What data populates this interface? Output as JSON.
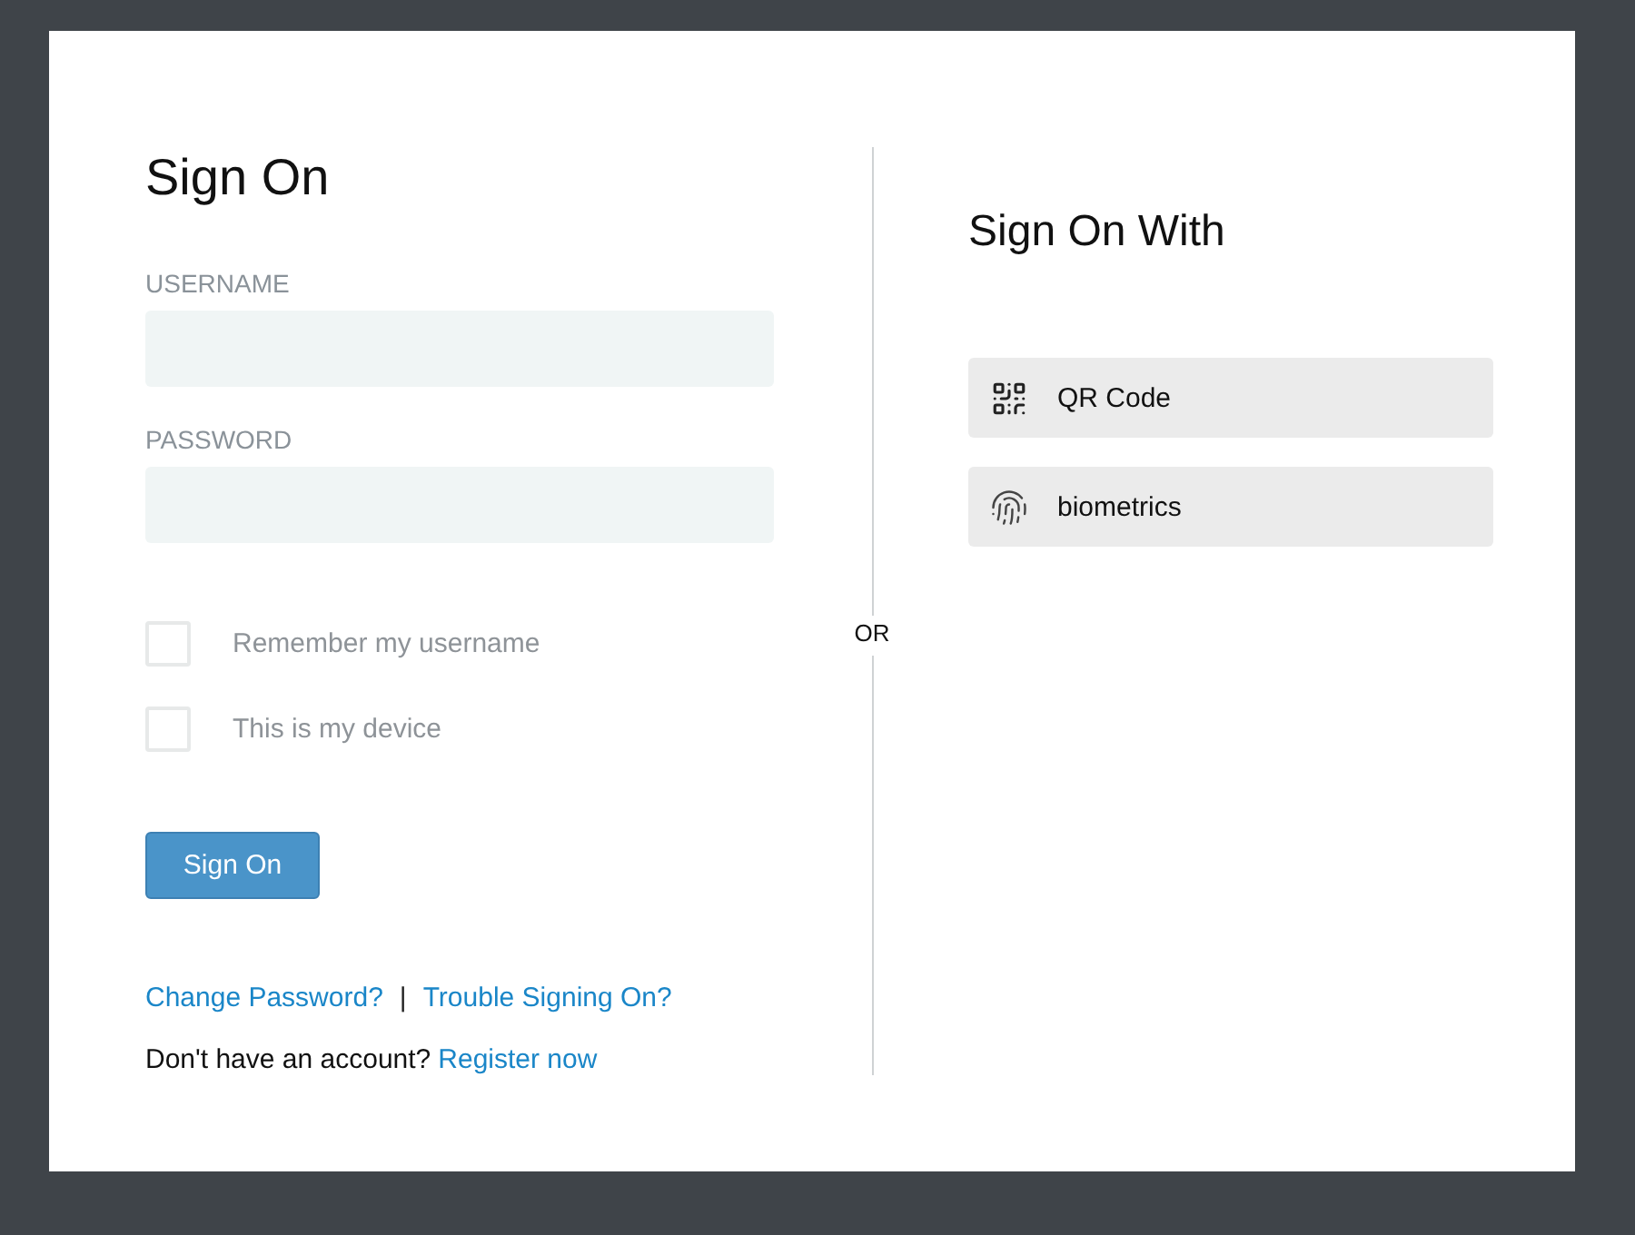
{
  "sign_on": {
    "title": "Sign On",
    "fields": [
      {
        "label": "USERNAME"
      },
      {
        "label": "PASSWORD"
      }
    ],
    "checkboxes": [
      {
        "label": "Remember my username",
        "checked": false
      },
      {
        "label": "This is my device",
        "checked": false
      }
    ],
    "submit_button": "Sign On",
    "links": [
      "Change Password?",
      "Trouble Signing On?"
    ],
    "link_separator": "|",
    "register": {
      "prompt": "Don't have an account?",
      "link": "Register now"
    }
  },
  "divider": {
    "label": "OR"
  },
  "sign_on_with": {
    "title": "Sign On With",
    "options": [
      {
        "label": "QR Code",
        "kind": "qr"
      },
      {
        "label": "biometrics",
        "kind": "fingerprint"
      }
    ]
  }
}
